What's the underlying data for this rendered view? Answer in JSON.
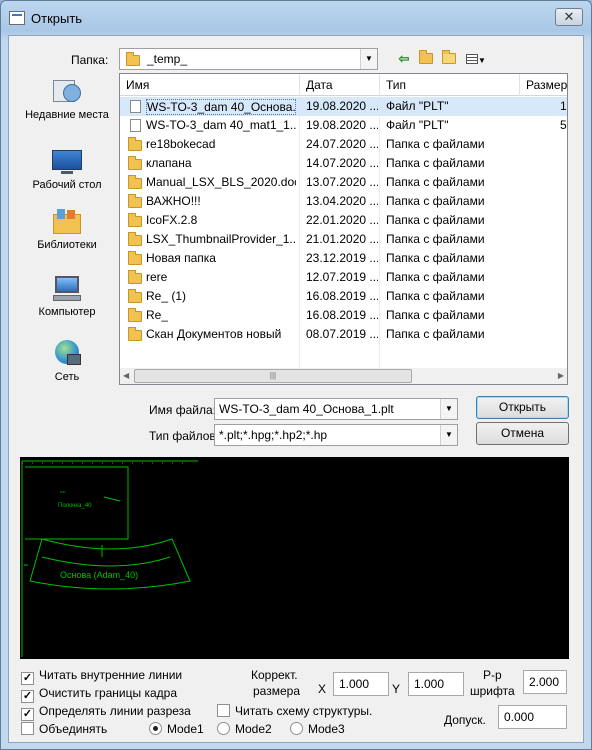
{
  "window": {
    "title": "Открыть",
    "close_glyph": "✕"
  },
  "toolbar": {
    "folder_label": "Папка:",
    "folder_value": "_temp_",
    "icons": [
      "back-arrow-icon",
      "up-folder-icon",
      "new-folder-icon",
      "view-menu-icon"
    ]
  },
  "places": [
    {
      "label": "Недавние места",
      "icon": "recent-places-icon"
    },
    {
      "label": "Рабочий стол",
      "icon": "desktop-icon"
    },
    {
      "label": "Библиотеки",
      "icon": "libraries-icon"
    },
    {
      "label": "Компьютер",
      "icon": "computer-icon"
    },
    {
      "label": "Сеть",
      "icon": "network-icon"
    }
  ],
  "file_list": {
    "columns": [
      "Имя",
      "Дата",
      "Тип",
      "Размер"
    ],
    "rows": [
      {
        "name": "WS-TO-3_dam 40_Основа...",
        "date": "19.08.2020 ...",
        "type": "Файл \"PLT\"",
        "size": "1",
        "kind": "file",
        "selected": true
      },
      {
        "name": "WS-TO-3_dam 40_mat1_1....",
        "date": "19.08.2020 ...",
        "type": "Файл \"PLT\"",
        "size": "5",
        "kind": "file"
      },
      {
        "name": "re18bokecad",
        "date": "24.07.2020 ...",
        "type": "Папка с файлами",
        "size": "",
        "kind": "folder"
      },
      {
        "name": "клапана",
        "date": "14.07.2020 ...",
        "type": "Папка с файлами",
        "size": "",
        "kind": "folder"
      },
      {
        "name": "Manual_LSX_BLS_2020.doc",
        "date": "13.07.2020 ...",
        "type": "Папка с файлами",
        "size": "",
        "kind": "folder"
      },
      {
        "name": "ВАЖНО!!!",
        "date": "13.04.2020 ...",
        "type": "Папка с файлами",
        "size": "",
        "kind": "folder"
      },
      {
        "name": "IcoFX.2.8",
        "date": "22.01.2020 ...",
        "type": "Папка с файлами",
        "size": "",
        "kind": "folder"
      },
      {
        "name": "LSX_ThumbnailProvider_1...",
        "date": "21.01.2020 ...",
        "type": "Папка с файлами",
        "size": "",
        "kind": "folder"
      },
      {
        "name": "Новая папка",
        "date": "23.12.2019 ...",
        "type": "Папка с файлами",
        "size": "",
        "kind": "folder"
      },
      {
        "name": "rere",
        "date": "12.07.2019 ...",
        "type": "Папка с файлами",
        "size": "",
        "kind": "folder"
      },
      {
        "name": "Re_ (1)",
        "date": "16.08.2019 ...",
        "type": "Папка с файлами",
        "size": "",
        "kind": "folder"
      },
      {
        "name": "Re_",
        "date": "16.08.2019 ...",
        "type": "Папка с файлами",
        "size": "",
        "kind": "folder"
      },
      {
        "name": "Скан Документов новый",
        "date": "08.07.2019 ...",
        "type": "Папка с файлами",
        "size": "",
        "kind": "folder"
      }
    ]
  },
  "filename": {
    "label": "Имя файла:",
    "value": "WS-TO-3_dam 40_Основа_1.plt"
  },
  "filetype": {
    "label": "Тип файлов:",
    "value": "*.plt;*.hpg;*.hp2;*.hp"
  },
  "buttons": {
    "open": "Открыть",
    "cancel": "Отмена"
  },
  "preview": {
    "label_top": "Полочка_40",
    "label_main": "Основа (Adam_40)",
    "colors": {
      "background": "#000000",
      "lines": "#00c000"
    }
  },
  "options": {
    "read_inner_lines": {
      "label": "Читать внутренние линии",
      "checked": true
    },
    "clear_frame_borders": {
      "label": "Очистить границы кадра",
      "checked": true
    },
    "detect_cut_lines": {
      "label": "Определять линии разреза",
      "checked": true
    },
    "merge": {
      "label": "Объединять",
      "checked": false
    },
    "read_structure": {
      "label": "Читать схему структуры.",
      "checked": false
    },
    "modes": [
      {
        "label": "Mode1",
        "selected": true
      },
      {
        "label": "Mode2",
        "selected": false
      },
      {
        "label": "Mode3",
        "selected": false
      }
    ],
    "size_correction_label_1": "Коррект.",
    "size_correction_label_2": "размера",
    "x_label": "X",
    "x_value": "1.000",
    "y_label": "Y",
    "y_value": "1.000",
    "font_size_label_1": "Р-р",
    "font_size_label_2": "шрифта",
    "font_size_value": "2.000",
    "tolerance_label": "Допуск.",
    "tolerance_value": "0.000"
  }
}
